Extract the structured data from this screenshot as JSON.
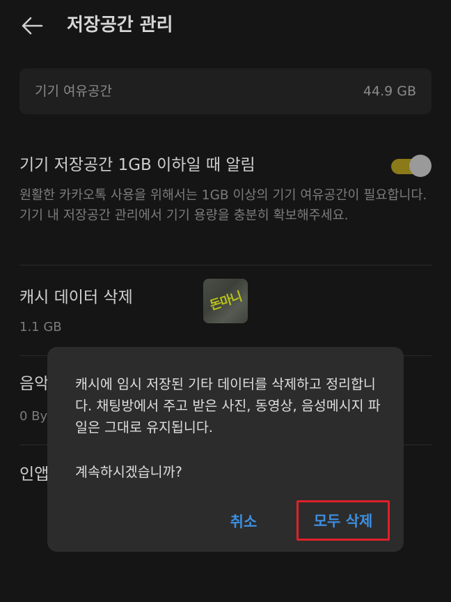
{
  "header": {
    "title": "저장공간 관리",
    "back_icon": "arrow-left-icon"
  },
  "free_space": {
    "label": "기기 여유공간",
    "value": "44.9 GB"
  },
  "low_storage_alert": {
    "title": "기기 저장공간 1GB 이하일 때 알림",
    "description": "원활한 카카오톡 사용을 위해서는 1GB 이상의 기기 여유공간이 필요합니다. 기기 내 저장공간 관리에서 기기 용량을 충분히 확보해주세요.",
    "toggle_on": true,
    "toggle_color": "#8a7a18"
  },
  "cache": {
    "title": "캐시 데이터 삭제",
    "size": "1.1 GB"
  },
  "watermark": {
    "text": "돈마니"
  },
  "partial_rows": {
    "row1_title": "음악",
    "row1_sub": "0 By",
    "row2_title": "인앱"
  },
  "dialog": {
    "message": "캐시에 임시 저장된 기타 데이터를 삭제하고 정리합니다. 채팅방에서 주고 받은 사진, 동영상, 음성메시지 파일은 그대로 유지됩니다.",
    "question": "계속하시겠습니까?",
    "cancel_label": "취소",
    "confirm_label": "모두 삭제",
    "accent_color": "#3d8fe0",
    "highlight_color": "#e0202a"
  }
}
